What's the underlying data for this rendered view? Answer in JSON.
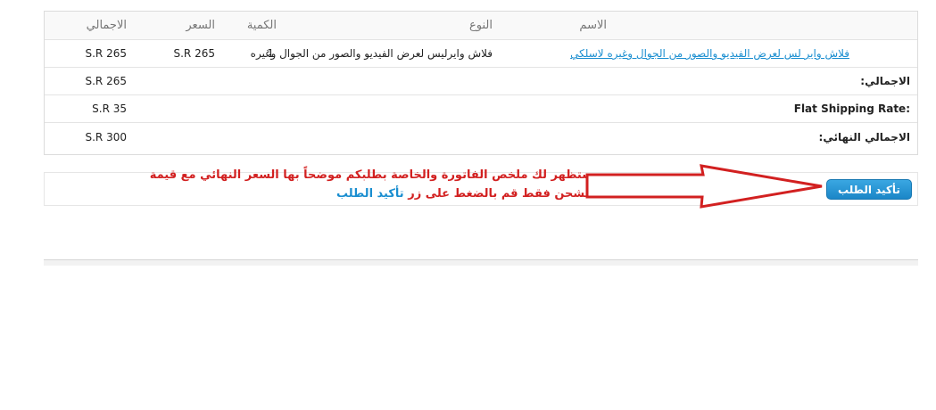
{
  "table": {
    "headers": {
      "name": "الاسم",
      "type": "النوع",
      "qty": "الكمية",
      "price": "السعر",
      "total": "الاجمالي"
    },
    "item": {
      "name": "فلاش واير لس لعرض الفيديو والصور من الجوال وغيره لاسلكي",
      "type": "فلاش وايرليس لعرض الفيديو والصور من الجوال وغيره",
      "qty": "1",
      "price": "S.R 265",
      "total": "S.R 265"
    },
    "summary": [
      {
        "label": "الاجمالي:",
        "value": "S.R 265"
      },
      {
        "label": "Flat Shipping Rate:",
        "value": "S.R 35"
      },
      {
        "label": "الاجمالي النهائي:",
        "value": "S.R 300"
      }
    ]
  },
  "confirm": {
    "button_label": "تأكيد الطلب"
  },
  "annotation": {
    "line1": "ستظهر لك ملخص الفاتورة والخاصة بطلبكم موضحاً بها السعر النهائي مع قيمة",
    "line2": "الشحن فقط قم بالضغط على زر",
    "highlight": "تأكيد الطلب"
  },
  "colors": {
    "link": "#1a8ed0",
    "annotation": "#d22020",
    "button": "#2396d6"
  }
}
